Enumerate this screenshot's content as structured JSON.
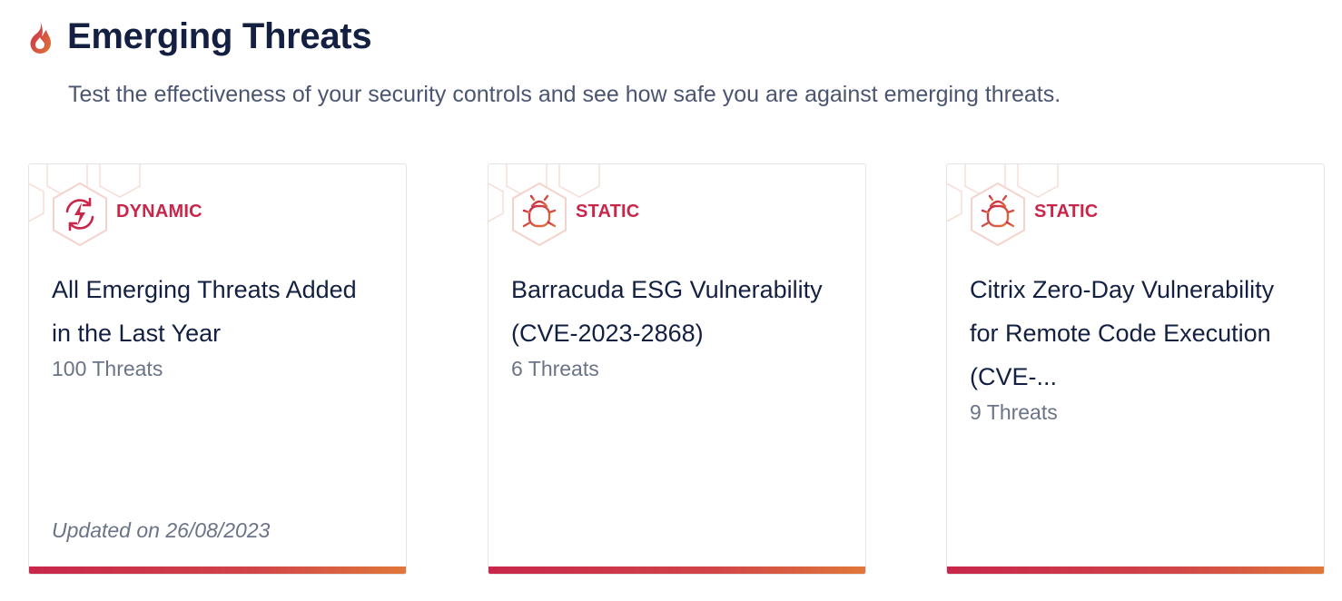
{
  "header": {
    "title": "Emerging Threats",
    "subtitle": "Test the effectiveness of your security controls and see how safe you are against emerging threats.",
    "icon": "flame-icon"
  },
  "colors": {
    "accent": "#c8264a",
    "accent_end": "#e0773a",
    "title": "#132041",
    "muted": "#6b7386"
  },
  "cards": [
    {
      "type": "DYNAMIC",
      "icon": "refresh-bolt-icon",
      "title": "All Emerging Threats Added in the Last Year",
      "count": "100 Threats",
      "updated": "Updated on 26/08/2023"
    },
    {
      "type": "STATIC",
      "icon": "bug-icon",
      "title": "Barracuda ESG Vulnerability (CVE-2023-2868)",
      "count": "6 Threats"
    },
    {
      "type": "STATIC",
      "icon": "bug-icon",
      "title": "Citrix Zero-Day Vulnerability for Remote Code Execution (CVE-...",
      "count": "9 Threats"
    }
  ]
}
